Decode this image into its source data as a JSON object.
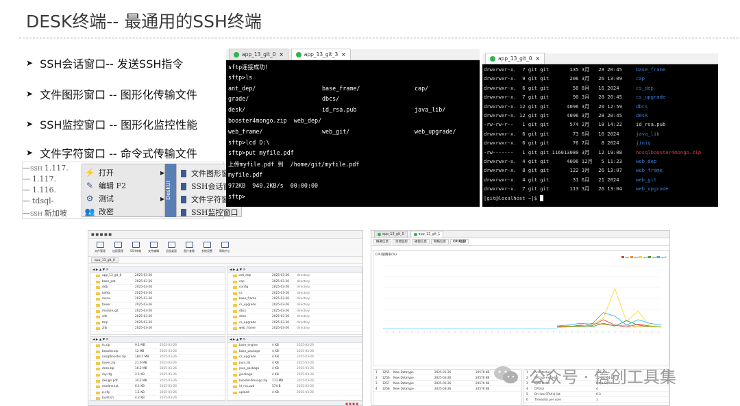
{
  "slide": {
    "title": "DESK终端-- 最通用的SSH终端",
    "bullets": [
      "SSH会话窗口-- 发送SSH指令",
      "文件图形窗口 -- 图形化传输文件",
      "SSH监控窗口 -- 图形化监控性能",
      "文件字符窗口 -- 命令式传输文件"
    ]
  },
  "menu_shot": {
    "tree_items": [
      {
        "tag": "SSH",
        "label": "1.117."
      },
      {
        "tag": "",
        "label": "1.117."
      },
      {
        "tag": "",
        "label": "1.116."
      },
      {
        "tag": "",
        "label": "tdsql-"
      },
      {
        "tag": "SSH",
        "label": "新加坡"
      }
    ],
    "context_menu": [
      {
        "icon": "lightning-icon",
        "label": "打开"
      },
      {
        "icon": "pencil-icon",
        "label": "编辑 F2"
      },
      {
        "icon": "network-icon",
        "label": "测试"
      },
      {
        "icon": "people-icon",
        "label": "改密"
      }
    ],
    "strip_label": "DeskUI",
    "submenu": [
      "文件图形窗口",
      "SSH会话窗口",
      "文件字符窗口",
      "SSH监控窗口"
    ]
  },
  "terminal1": {
    "tabs": [
      "app_13_git_0",
      "app_13_git_3"
    ],
    "lines": [
      {
        "cols": [
          "sftp连接成功！"
        ]
      },
      {
        "cols": [
          "sftp>ls"
        ]
      },
      {
        "cols": [
          "ant_dep/",
          "base_frame/",
          "cap/"
        ]
      },
      {
        "cols": [
          "grade/",
          "dbcs/",
          ""
        ]
      },
      {
        "cols": [
          "desk/",
          "id_rsa.pub",
          "java_lib/"
        ]
      },
      {
        "cols": [
          "booster4mongo.zip  web_dep/",
          "",
          ""
        ]
      },
      {
        "cols": [
          "web_frame/",
          "web_git/",
          "web_upgrade/"
        ]
      },
      {
        "cols": [
          "sftp>lcd D:\\"
        ]
      },
      {
        "cols": [
          "sftp>put myfile.pdf"
        ]
      },
      {
        "cols": [
          "上传myfile.pdf 到  /home/git/myfile.pdf"
        ]
      },
      {
        "cols": [
          "myfile.pdf"
        ]
      },
      {
        "cols": [
          "972KB  940.2KB/s  00:00:00"
        ]
      },
      {
        "cols": [
          "sftp>"
        ]
      }
    ]
  },
  "terminal2": {
    "tab": "app_13_git_0",
    "rows": [
      {
        "perm": "drwxrwxr-x.  7 git git       135 3月   28 20:45",
        "name": "base_frame",
        "color": "blue"
      },
      {
        "perm": "drwxrwxr-x.  9 git git       206 3月   26 13:09",
        "name": "cap",
        "color": "blue"
      },
      {
        "perm": "drwxrwxr-x.  6 git git        56 8月   16 2024",
        "name": "cs_dep",
        "color": "blue"
      },
      {
        "perm": "drwxrwxr-x.  7 git git        90 3月   28 20:45",
        "name": "cs_upgrade",
        "color": "blue"
      },
      {
        "perm": "drwxrwxr-x. 12 git git      4096 3月   20 12:59",
        "name": "dbcs",
        "color": "blue"
      },
      {
        "perm": "drwxrwxr-x. 12 git git      4096 3月   28 20:45",
        "name": "desk",
        "color": "blue"
      },
      {
        "perm": "-rw-rw-r--   1 git git       574 2月   18 14:22",
        "name": "id_rsa.pub",
        "color": "white"
      },
      {
        "perm": "drwxrwxr-x.  6 git git        73 6月   16 2024",
        "name": "java_lib",
        "color": "blue"
      },
      {
        "perm": "drwxrwxr-x.  6 git git        76 7月    8 2024",
        "name": "jiniq",
        "color": "blue"
      },
      {
        "perm": "-rw-------   1 git git 116013080 3月   12 19:08",
        "name": "nosqlbooster4mongo.zip",
        "color": "red"
      },
      {
        "perm": "drwxrwxr-x.  4 git git      4096 12月   5 11:23",
        "name": "web_dep",
        "color": "blue"
      },
      {
        "perm": "drwxrwxr-x.  8 git git       122 3月   26 13:07",
        "name": "web_frame",
        "color": "blue"
      },
      {
        "perm": "drwxrwxr-x.  4 git git        31 6月   21 2024",
        "name": "web_git",
        "color": "blue"
      },
      {
        "perm": "drwxrwxr-x.  7 git git       113 3月   26 13:04",
        "name": "web_upgrade",
        "color": "blue"
      }
    ],
    "prompt": "[git@localhost ~]$"
  },
  "file_manager": {
    "tab_label": "app_13_git_0",
    "toolbar": [
      "文件管理",
      "连接管理",
      "SSH终端",
      "文件编辑",
      "远程桌面",
      "图片查看",
      "系统设置",
      "帮助中心"
    ],
    "left_top_rows": [
      [
        "app_13_git_0",
        "2025-03-26",
        "",
        ""
      ],
      [
        "base_pat",
        "2025-03-26",
        "",
        ""
      ],
      [
        "ddb",
        "2025-03-26",
        "",
        ""
      ],
      [
        "kafka",
        "2025-03-26",
        "",
        ""
      ],
      [
        "menu",
        "2025-03-26",
        "",
        ""
      ],
      [
        "tower",
        "2025-03-26",
        "",
        ""
      ],
      [
        "module_git",
        "2025-03-26",
        "",
        ""
      ],
      [
        "sdk",
        "2025-03-26",
        "",
        ""
      ],
      [
        "tmp",
        "2025-03-26",
        "",
        ""
      ],
      [
        "zlib",
        "2025-03-26",
        "",
        ""
      ]
    ],
    "right_top_rows": [
      [
        "ant_dep",
        "2025-03-26",
        "directory",
        ""
      ],
      [
        "cap",
        "2025-03-26",
        "directory",
        ""
      ],
      [
        "config",
        "2025-03-26",
        "directory",
        ""
      ],
      [
        "cs",
        "2025-03-26",
        "directory",
        ""
      ],
      [
        "base_frame",
        "2025-03-26",
        "directory",
        ""
      ],
      [
        "cs_upgrade",
        "2025-03-26",
        "directory",
        ""
      ],
      [
        "dbcs",
        "2025-03-26",
        "directory",
        ""
      ],
      [
        "desk",
        "2025-03-26",
        "directory",
        ""
      ],
      [
        "cs_upgrade",
        "2025-03-26",
        "directory",
        ""
      ],
      [
        "web_frame",
        "2025-03-26",
        "directory",
        ""
      ]
    ],
    "left_bottom_rows": [
      [
        "ts.zip",
        "9.1 MB",
        "2025-03-26",
        ""
      ],
      [
        "booster.zip",
        "12 MB",
        "2025-03-26",
        ""
      ],
      [
        "nosqlbooster.zip",
        "184.5 MB",
        "2025-03-26",
        ""
      ],
      [
        "tower.zip",
        "21.6 MB",
        "2025-03-26",
        ""
      ],
      [
        "desk.zip",
        "16.2 MB",
        "2025-03-26",
        ""
      ],
      [
        "my.cfg",
        "2.1 KB",
        "2025-03-26",
        ""
      ],
      [
        "design.pdf",
        "34.2 MB",
        "2025-03-26",
        ""
      ],
      [
        "readme.txt",
        "6.1 KB",
        "2025-03-26",
        ""
      ],
      [
        "p.cfg",
        "1.1 KB",
        "2025-03-26",
        ""
      ],
      [
        "build.sh",
        "4.2 KB",
        "2025-03-26",
        ""
      ]
    ],
    "right_bottom_rows": [
      [
        "base_engine",
        "4 KB",
        "2025-03-26",
        ""
      ],
      [
        "base_package",
        "4 KB",
        "2025-03-26",
        ""
      ],
      [
        "cs_upgrade",
        "4 KB",
        "2025-03-26",
        ""
      ],
      [
        "java_lib",
        "4 KB",
        "2025-03-26",
        ""
      ],
      [
        "java_package",
        "4 KB",
        "2025-03-26",
        ""
      ],
      [
        "jpackage",
        "4 KB",
        "2025-03-26",
        ""
      ],
      [
        "booster4mongo.zip",
        "113 MB",
        "2025-03-26",
        ""
      ],
      [
        "id_rsa.pub",
        "574 B",
        "2025-03-26",
        ""
      ],
      [
        "upload",
        "4 KB",
        "2025-03-26",
        ""
      ]
    ]
  },
  "monitor": {
    "tabs": [
      "app_13_git_0",
      "app_13_git_1"
    ],
    "subtabs": [
      "概要信息",
      "资源监控",
      "磁盘信息",
      "网络信息",
      "CPU监控"
    ],
    "chart_title": "CPU使用率(%)",
    "legend": [
      "cpu",
      "cpu0",
      "cpu1",
      "cpu2",
      "cpu3"
    ],
    "legend_colors": [
      "#e53935",
      "#fb8c00",
      "#fdd835",
      "#43a047",
      "#29b6f6"
    ],
    "left_table_rows": [
      [
        "1",
        "1255",
        "New Datatype",
        "2025-03-26",
        "24576 KB"
      ],
      [
        "2",
        "1256",
        "New Datatype",
        "2025-03-26",
        "24576 KB"
      ],
      [
        "3",
        "1257",
        "New Datatype",
        "2025-03-26",
        "24576 KB"
      ],
      [
        "4",
        "1258",
        "New Datatype",
        "2025-03-26",
        "24576 KB"
      ]
    ],
    "right_table_rows": [
      [
        "1",
        "Architecture",
        "x86_64"
      ],
      [
        "2",
        "CPU op-mode(s)",
        "32-bit, 64-bit"
      ],
      [
        "3",
        "Byte Order",
        "Little Endian"
      ],
      [
        "4",
        "CPU(s)",
        "4"
      ],
      [
        "5",
        "On-line CPU(s) list",
        "0-3"
      ],
      [
        "6",
        "Thread(s) per core",
        "1"
      ]
    ]
  },
  "watermark": {
    "text": "公众号 · 信创工具集"
  }
}
